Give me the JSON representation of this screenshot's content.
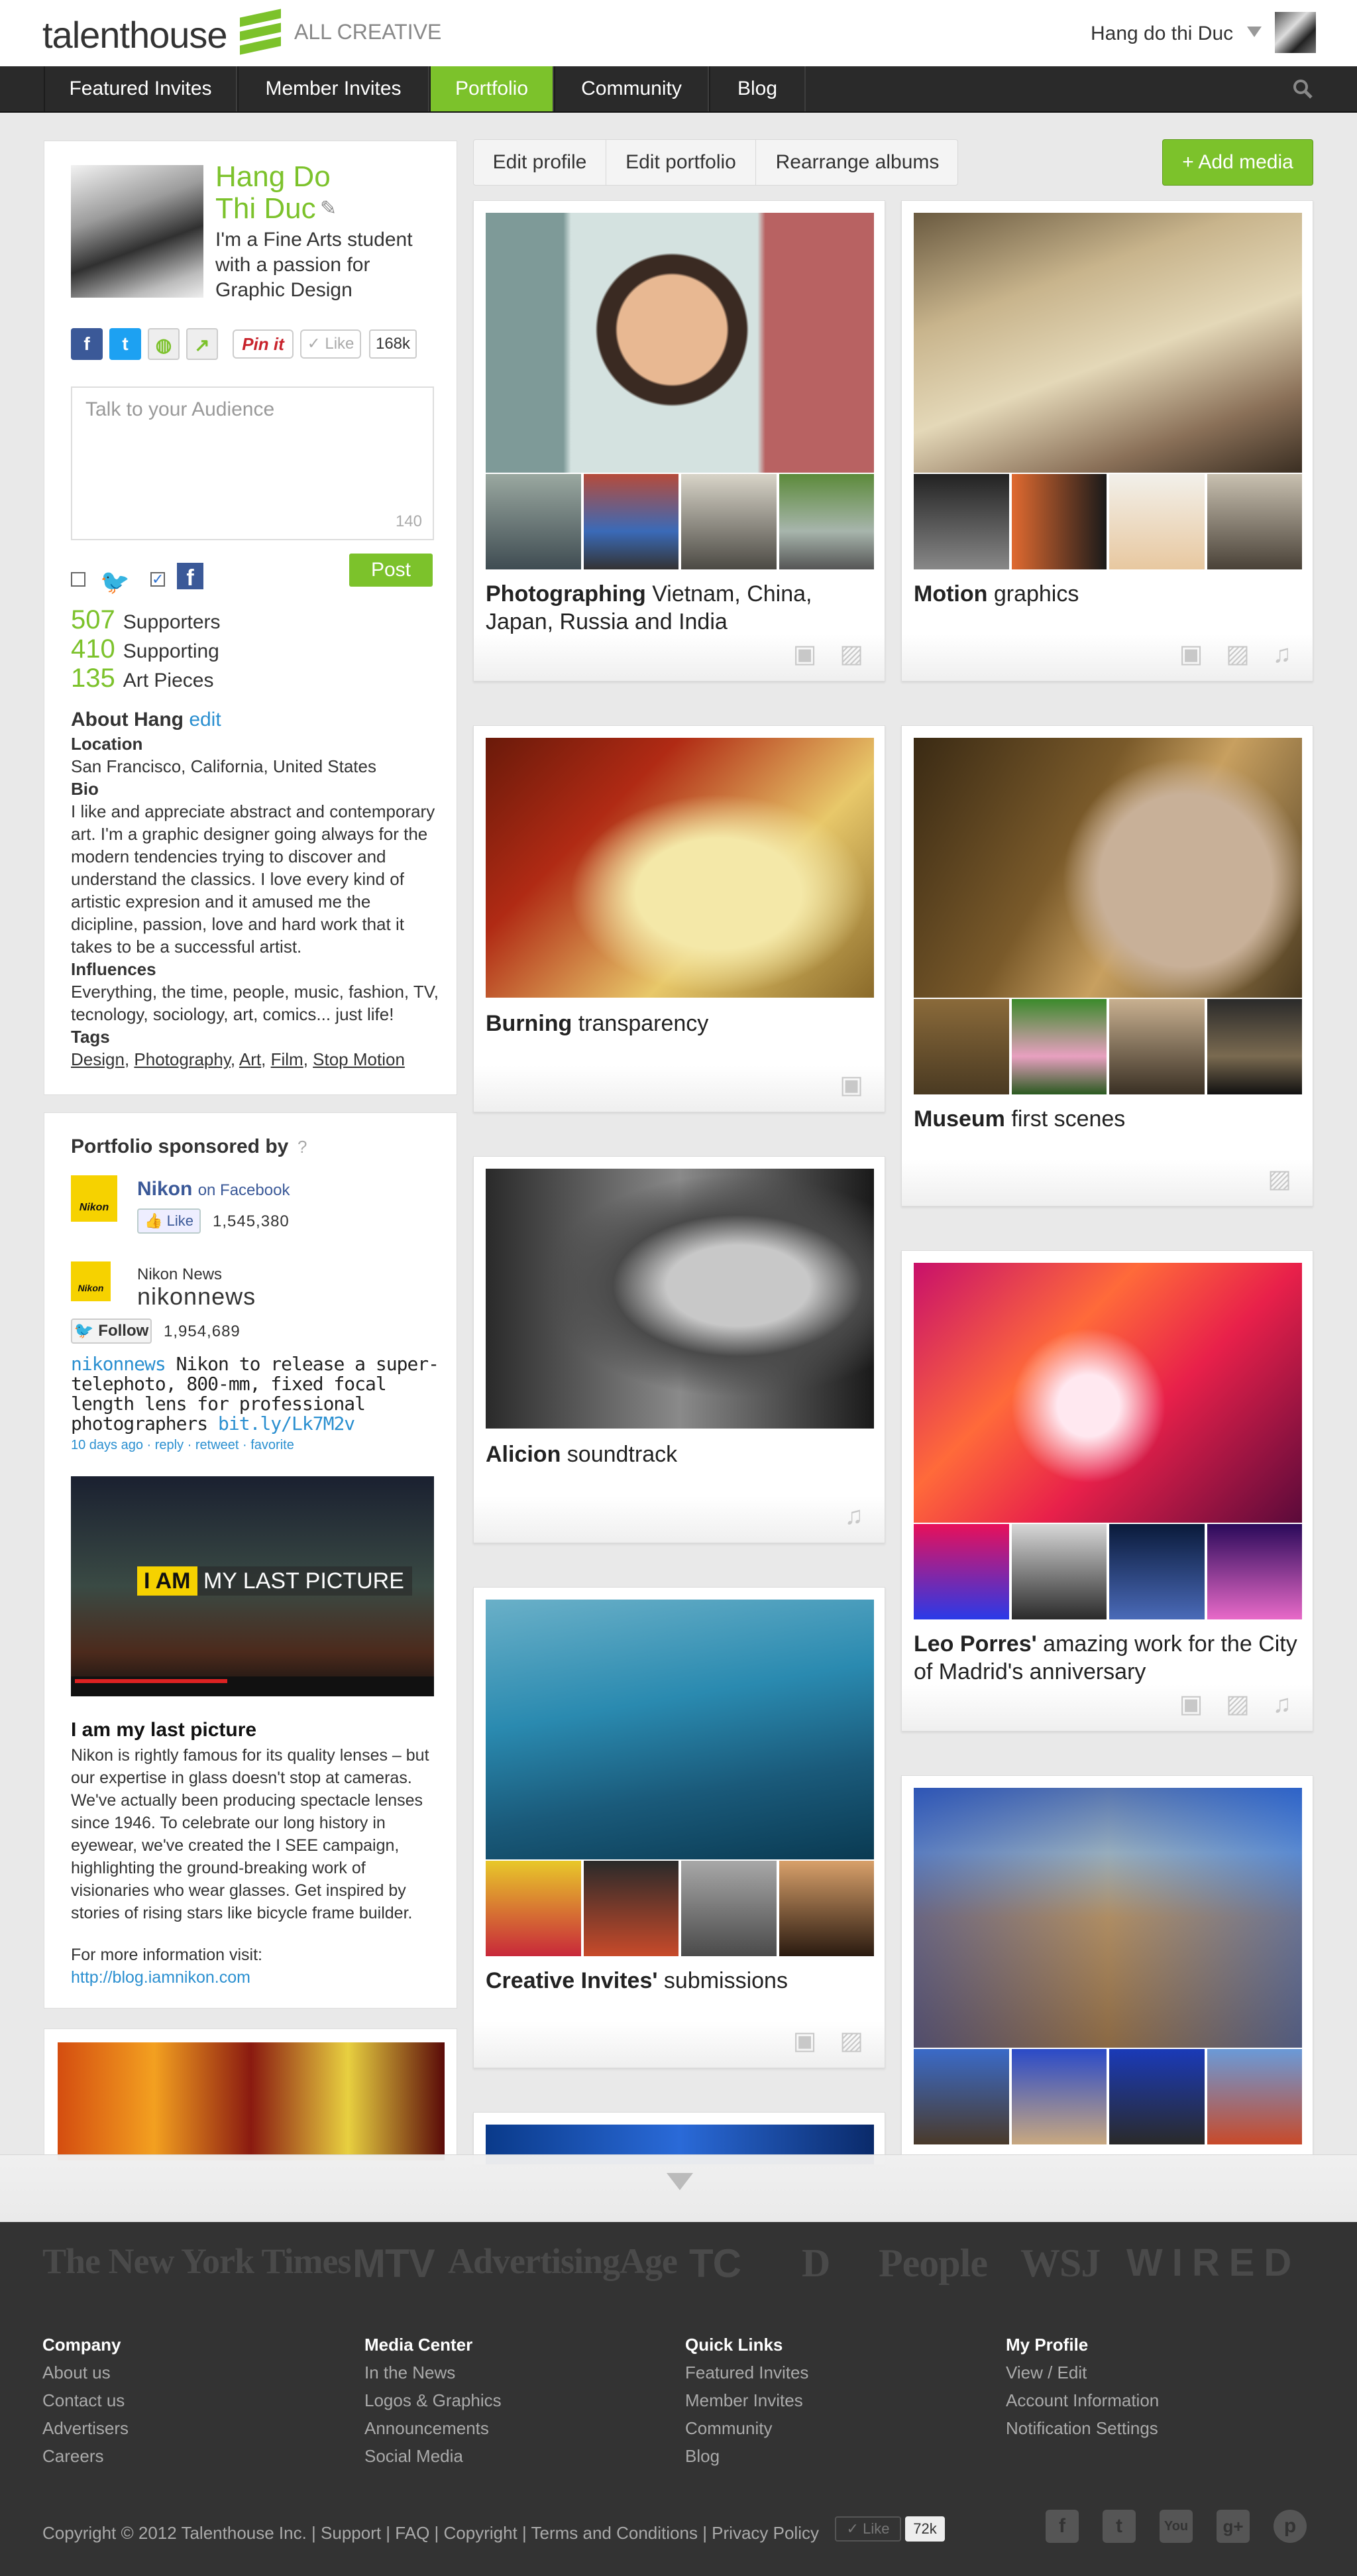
{
  "header": {
    "logo": "talenthouse",
    "tagline": "ALL CREATIVE",
    "user_name": "Hang do thi Duc"
  },
  "nav": {
    "items": [
      "Featured Invites",
      "Member Invites",
      "Portfolio",
      "Community",
      "Blog"
    ],
    "active": "Portfolio"
  },
  "profile": {
    "name_line1": "Hang Do",
    "name_line2": "Thi Duc",
    "tagline": "I'm a Fine Arts student with a passion for Graphic Design",
    "share": {
      "pinit": "Pin it",
      "like": "✓ Like",
      "like_count": "168k"
    },
    "composer": {
      "placeholder": "Talk to your Audience",
      "char_count": "140",
      "post": "Post"
    },
    "stats": [
      {
        "value": "507",
        "label": "Supporters"
      },
      {
        "value": "410",
        "label": "Supporting"
      },
      {
        "value": "135",
        "label": "Art Pieces"
      }
    ],
    "about": {
      "title": "About Hang",
      "edit": "edit",
      "location_label": "Location",
      "location": "San Francisco, California, United States",
      "bio_label": "Bio",
      "bio": "I like and appreciate abstract and contemporary art. I'm a graphic designer going always for the modern tendencies trying to discover and understand the classics. I love every kind of artistic expresion and it amused me the dicipline, passion, love and hard work that it takes to be a successful artist.",
      "influences_label": "Influences",
      "influences": "Everything, the time, people, music, fashion, TV, tecnology, sociology, art, comics... just life!",
      "tags_label": "Tags",
      "tags": [
        "Design",
        "Photography",
        "Art",
        "Film",
        "Stop Motion"
      ]
    }
  },
  "sponsor": {
    "title": "Portfolio sponsored by",
    "help": "?",
    "fb_brand": "Nikon",
    "fb_suffix": "on Facebook",
    "fb_like": "Like",
    "fb_count": "1,545,380",
    "news_label": "Nikon News",
    "handle": "nikonnews",
    "follow": "Follow",
    "follow_count": "1,954,689",
    "tweet_user": "nikonnews",
    "tweet_text": "Nikon to release a super-telephoto, 800-mm, fixed focal length lens for professional photographers",
    "tweet_link": "bit.ly/Lk7M2v",
    "tweet_meta": "10 days ago · reply · retweet · favorite",
    "video_tag": "I AM",
    "video_title": "MY LAST PICTURE",
    "article_title": "I am my last picture",
    "article_body": "Nikon is rightly famous for its quality lenses – but our expertise in glass doesn't stop at cameras. We've actually been producing spectacle lenses since 1946. To celebrate our long history in eyewear, we've created the I SEE campaign, highlighting the ground-breaking work of visionaries who wear glasses.  Get inspired by stories of rising stars like bicycle frame builder.",
    "more_info": "For more information visit:",
    "url": "http://blog.iamnikon.com"
  },
  "toolbar": {
    "tabs": [
      "Edit profile",
      "Edit portfolio",
      "Rearrange albums"
    ],
    "add_media": "+ Add media"
  },
  "albums": [
    {
      "bold": "Photographing",
      "rest": " Vietnam, China, Japan, Russia and India",
      "icons": "▣ ▨"
    },
    {
      "bold": "Motion",
      "rest": " graphics",
      "icons": "▣ ▨ ♫"
    },
    {
      "bold": "Burning",
      "rest": " transparency",
      "icons": "▣"
    },
    {
      "bold": "Museum",
      "rest": " first scenes",
      "icons": "▨"
    },
    {
      "bold": "Alicion",
      "rest": " soundtrack",
      "icons": "♫"
    },
    {
      "bold": "Leo Porres'",
      "rest": " amazing work for the City of Madrid's anniversary",
      "icons": "▣ ▨ ♫"
    },
    {
      "bold": "Creative Invites'",
      "rest": " submissions",
      "icons": "▣ ▨"
    }
  ],
  "press": [
    "The New York Times",
    "MTV",
    "AdvertisingAge",
    "TC",
    "D",
    "People",
    "WSJ",
    "WIRED"
  ],
  "footer": {
    "columns": [
      {
        "title": "Company",
        "links": [
          "About us",
          "Contact us",
          "Advertisers",
          "Careers"
        ]
      },
      {
        "title": "Media Center",
        "links": [
          "In the News",
          "Logos & Graphics",
          "Announcements",
          "Social Media"
        ]
      },
      {
        "title": "Quick Links",
        "links": [
          "Featured Invites",
          "Member Invites",
          "Community",
          "Blog"
        ]
      },
      {
        "title": "My Profile",
        "links": [
          "View / Edit",
          "Account Information",
          "Notification Settings"
        ]
      }
    ],
    "copyright": "Copyright © 2012 Talenthouse Inc. | Support | FAQ | Copyright | Terms and Conditions | Privacy Policy",
    "like": "✓ Like",
    "like_count": "72k",
    "social": [
      "f",
      "t",
      "You",
      "g+",
      "p"
    ]
  },
  "colors": {
    "accent": "#7cc22b",
    "nav": "#2a2a2a",
    "footer": "#333333",
    "link": "#2a8fd0"
  }
}
